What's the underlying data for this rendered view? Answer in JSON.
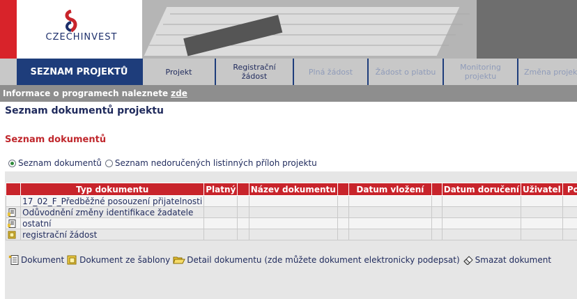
{
  "header": {
    "logo_text_part1": "CZECH",
    "logo_text_part2": "INVEST"
  },
  "nav": {
    "active_label": "SEZNAM PROJEKTŮ",
    "tabs": [
      {
        "label": "Projekt",
        "enabled": true
      },
      {
        "label": "Registrační žádost",
        "enabled": true
      },
      {
        "label": "Plná žádost",
        "enabled": false
      },
      {
        "label": "Žádost o platbu",
        "enabled": false
      },
      {
        "label": "Monitoring projektu",
        "enabled": false
      },
      {
        "label": "Změna projektu",
        "enabled": false
      }
    ]
  },
  "info": {
    "text": "Informace o programech naleznete",
    "link": "zde"
  },
  "page_title": "Seznam dokumentů projektu",
  "section_title": "Seznam dokumentů",
  "radios": [
    {
      "label": "Seznam dokumentů",
      "selected": true
    },
    {
      "label": "Seznam nedoručených listinných příloh projektu",
      "selected": false
    }
  ],
  "table": {
    "columns": [
      "Typ dokumentu",
      "Platný",
      "",
      "Název dokumentu",
      "",
      "Datum vložení",
      "",
      "Datum doručení",
      "Uživatel",
      "Po"
    ],
    "rows": [
      {
        "icon": "",
        "type": "17_02_F_Předběžné posouzení přijatelnosti"
      },
      {
        "icon": "document-icon",
        "type": "Odůvodnění změny identifikace žadatele"
      },
      {
        "icon": "document-icon",
        "type": "ostatní"
      },
      {
        "icon": "template-icon",
        "type": "registrační žádost"
      }
    ]
  },
  "actions": [
    {
      "icon": "document-icon",
      "label": "Dokument"
    },
    {
      "icon": "template-icon",
      "label": "Dokument ze šablony"
    },
    {
      "icon": "folder-open-icon",
      "label": "Detail dokumentu (zde můžete dokument elektronicky podepsat)"
    },
    {
      "icon": "eraser-icon",
      "label": "Smazat dokument"
    }
  ],
  "colors": {
    "brand_red": "#d8232a",
    "nav_blue": "#1e3d7b",
    "header_red": "#c8242b"
  }
}
